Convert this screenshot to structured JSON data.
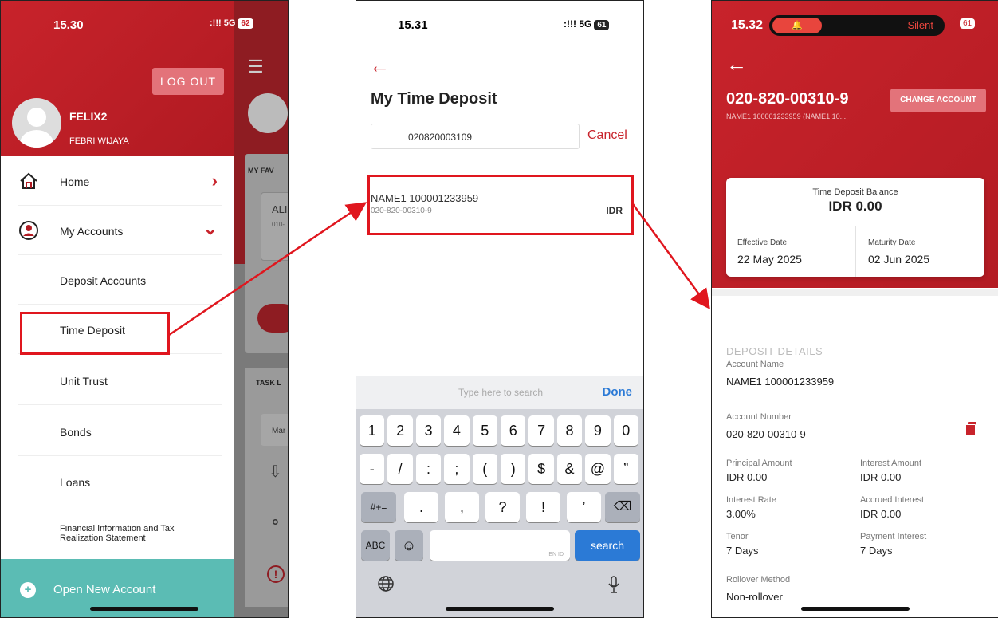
{
  "phone1": {
    "status": {
      "time": "15.30",
      "signal": ":!!! 5G",
      "battery": "62"
    },
    "logout_label": "LOG OUT",
    "user": {
      "name": "FELIX2",
      "sub": "FEBRI WIJAYA"
    },
    "menu": [
      {
        "label": "Home"
      },
      {
        "label": "My Accounts"
      },
      {
        "label": "Deposit Accounts"
      },
      {
        "label": "Time Deposit"
      },
      {
        "label": "Unit Trust"
      },
      {
        "label": "Bonds"
      },
      {
        "label": "Loans"
      },
      {
        "label": "Financial Information and Tax Realization Statement"
      }
    ],
    "open_account_label": "Open New Account",
    "background_labels": {
      "fav": "MY FAV",
      "ali": "ALI",
      "ali_sub": "010-",
      "task": "TASK L",
      "mar": "Mar"
    }
  },
  "phone2": {
    "status": {
      "time": "15.31",
      "signal": ":!!! 5G",
      "battery": "61"
    },
    "title": "My Time Deposit",
    "search_value": "020820003109",
    "cancel_label": "Cancel",
    "result": {
      "name": "NAME1 100001233959",
      "account": "020-820-00310-9",
      "currency": "IDR"
    },
    "keyboard": {
      "placeholder": "Type here to search",
      "done": "Done",
      "row1": [
        "1",
        "2",
        "3",
        "4",
        "5",
        "6",
        "7",
        "8",
        "9",
        "0"
      ],
      "row2": [
        "-",
        "/",
        ":",
        ";",
        "(",
        ")",
        "$",
        "&",
        "@",
        "”"
      ],
      "row3": [
        ".",
        ",",
        "?",
        "!",
        "’"
      ],
      "symbols": "#+=",
      "abc": "ABC",
      "search": "search",
      "lang": "EN ID"
    }
  },
  "phone3": {
    "status": {
      "time": "15.32",
      "silent": "Silent",
      "battery": "61"
    },
    "account_number": "020-820-00310-9",
    "account_sub": "NAME1 100001233959 (NAME1 10...",
    "change_account_label": "CHANGE ACCOUNT",
    "balance_label": "Time Deposit Balance",
    "balance_value": "IDR 0.00",
    "effective_date_label": "Effective Date",
    "effective_date": "22 May 2025",
    "maturity_date_label": "Maturity Date",
    "maturity_date": "02 Jun 2025",
    "details_title": "DEPOSIT DETAILS",
    "fields": {
      "account_name_label": "Account Name",
      "account_name": "NAME1 100001233959",
      "account_number_label": "Account Number",
      "account_number": "020-820-00310-9",
      "principal_label": "Principal Amount",
      "principal": "IDR 0.00",
      "interest_amount_label": "Interest Amount",
      "interest_amount": "IDR 0.00",
      "interest_rate_label": "Interest Rate",
      "interest_rate": "3.00%",
      "accrued_label": "Accrued Interest",
      "accrued": "IDR 0.00",
      "tenor_label": "Tenor",
      "tenor": "7 Days",
      "payment_interest_label": "Payment Interest",
      "payment_interest": "7 Days",
      "rollover_label": "Rollover Method",
      "rollover": "Non-rollover"
    }
  },
  "colors": {
    "brand_red": "#c8232b",
    "highlight_red": "#e0161e",
    "teal": "#5bbcb4",
    "ios_blue": "#2b7ad6"
  }
}
